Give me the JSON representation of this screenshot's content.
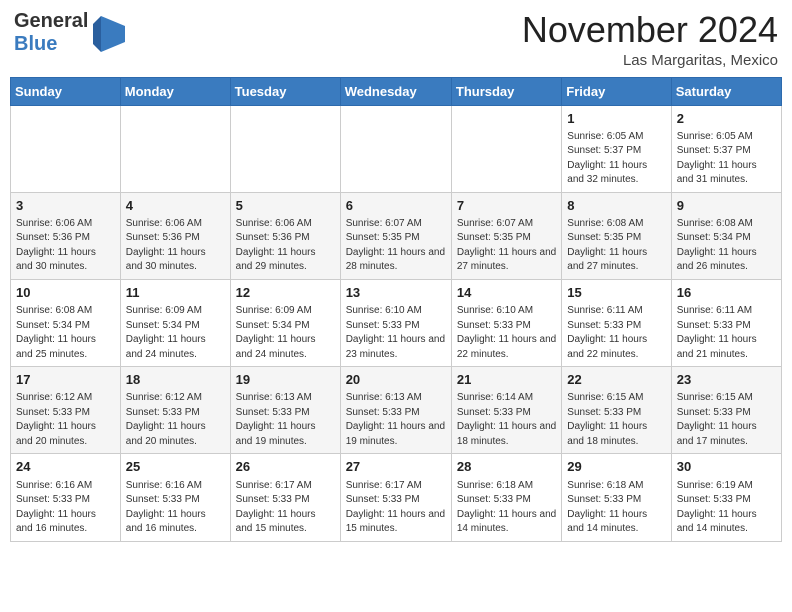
{
  "header": {
    "logo_general": "General",
    "logo_blue": "Blue",
    "month_title": "November 2024",
    "location": "Las Margaritas, Mexico"
  },
  "weekdays": [
    "Sunday",
    "Monday",
    "Tuesday",
    "Wednesday",
    "Thursday",
    "Friday",
    "Saturday"
  ],
  "rows": [
    [
      {
        "day": "",
        "info": ""
      },
      {
        "day": "",
        "info": ""
      },
      {
        "day": "",
        "info": ""
      },
      {
        "day": "",
        "info": ""
      },
      {
        "day": "",
        "info": ""
      },
      {
        "day": "1",
        "info": "Sunrise: 6:05 AM\nSunset: 5:37 PM\nDaylight: 11 hours and 32 minutes."
      },
      {
        "day": "2",
        "info": "Sunrise: 6:05 AM\nSunset: 5:37 PM\nDaylight: 11 hours and 31 minutes."
      }
    ],
    [
      {
        "day": "3",
        "info": "Sunrise: 6:06 AM\nSunset: 5:36 PM\nDaylight: 11 hours and 30 minutes."
      },
      {
        "day": "4",
        "info": "Sunrise: 6:06 AM\nSunset: 5:36 PM\nDaylight: 11 hours and 30 minutes."
      },
      {
        "day": "5",
        "info": "Sunrise: 6:06 AM\nSunset: 5:36 PM\nDaylight: 11 hours and 29 minutes."
      },
      {
        "day": "6",
        "info": "Sunrise: 6:07 AM\nSunset: 5:35 PM\nDaylight: 11 hours and 28 minutes."
      },
      {
        "day": "7",
        "info": "Sunrise: 6:07 AM\nSunset: 5:35 PM\nDaylight: 11 hours and 27 minutes."
      },
      {
        "day": "8",
        "info": "Sunrise: 6:08 AM\nSunset: 5:35 PM\nDaylight: 11 hours and 27 minutes."
      },
      {
        "day": "9",
        "info": "Sunrise: 6:08 AM\nSunset: 5:34 PM\nDaylight: 11 hours and 26 minutes."
      }
    ],
    [
      {
        "day": "10",
        "info": "Sunrise: 6:08 AM\nSunset: 5:34 PM\nDaylight: 11 hours and 25 minutes."
      },
      {
        "day": "11",
        "info": "Sunrise: 6:09 AM\nSunset: 5:34 PM\nDaylight: 11 hours and 24 minutes."
      },
      {
        "day": "12",
        "info": "Sunrise: 6:09 AM\nSunset: 5:34 PM\nDaylight: 11 hours and 24 minutes."
      },
      {
        "day": "13",
        "info": "Sunrise: 6:10 AM\nSunset: 5:33 PM\nDaylight: 11 hours and 23 minutes."
      },
      {
        "day": "14",
        "info": "Sunrise: 6:10 AM\nSunset: 5:33 PM\nDaylight: 11 hours and 22 minutes."
      },
      {
        "day": "15",
        "info": "Sunrise: 6:11 AM\nSunset: 5:33 PM\nDaylight: 11 hours and 22 minutes."
      },
      {
        "day": "16",
        "info": "Sunrise: 6:11 AM\nSunset: 5:33 PM\nDaylight: 11 hours and 21 minutes."
      }
    ],
    [
      {
        "day": "17",
        "info": "Sunrise: 6:12 AM\nSunset: 5:33 PM\nDaylight: 11 hours and 20 minutes."
      },
      {
        "day": "18",
        "info": "Sunrise: 6:12 AM\nSunset: 5:33 PM\nDaylight: 11 hours and 20 minutes."
      },
      {
        "day": "19",
        "info": "Sunrise: 6:13 AM\nSunset: 5:33 PM\nDaylight: 11 hours and 19 minutes."
      },
      {
        "day": "20",
        "info": "Sunrise: 6:13 AM\nSunset: 5:33 PM\nDaylight: 11 hours and 19 minutes."
      },
      {
        "day": "21",
        "info": "Sunrise: 6:14 AM\nSunset: 5:33 PM\nDaylight: 11 hours and 18 minutes."
      },
      {
        "day": "22",
        "info": "Sunrise: 6:15 AM\nSunset: 5:33 PM\nDaylight: 11 hours and 18 minutes."
      },
      {
        "day": "23",
        "info": "Sunrise: 6:15 AM\nSunset: 5:33 PM\nDaylight: 11 hours and 17 minutes."
      }
    ],
    [
      {
        "day": "24",
        "info": "Sunrise: 6:16 AM\nSunset: 5:33 PM\nDaylight: 11 hours and 16 minutes."
      },
      {
        "day": "25",
        "info": "Sunrise: 6:16 AM\nSunset: 5:33 PM\nDaylight: 11 hours and 16 minutes."
      },
      {
        "day": "26",
        "info": "Sunrise: 6:17 AM\nSunset: 5:33 PM\nDaylight: 11 hours and 15 minutes."
      },
      {
        "day": "27",
        "info": "Sunrise: 6:17 AM\nSunset: 5:33 PM\nDaylight: 11 hours and 15 minutes."
      },
      {
        "day": "28",
        "info": "Sunrise: 6:18 AM\nSunset: 5:33 PM\nDaylight: 11 hours and 14 minutes."
      },
      {
        "day": "29",
        "info": "Sunrise: 6:18 AM\nSunset: 5:33 PM\nDaylight: 11 hours and 14 minutes."
      },
      {
        "day": "30",
        "info": "Sunrise: 6:19 AM\nSunset: 5:33 PM\nDaylight: 11 hours and 14 minutes."
      }
    ]
  ]
}
